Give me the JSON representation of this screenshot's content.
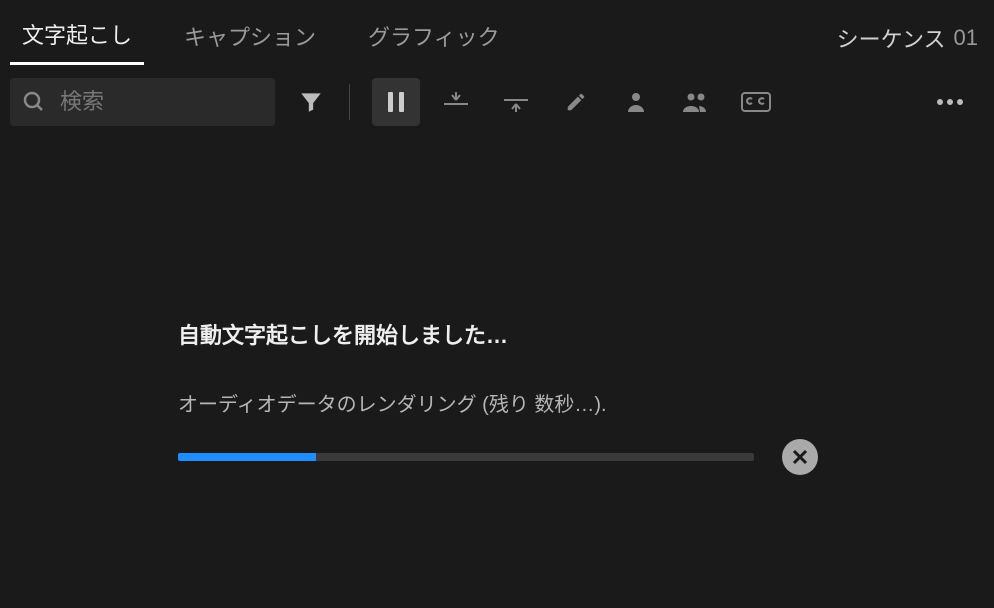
{
  "tabs": {
    "items": [
      {
        "label": "文字起こし",
        "active": true
      },
      {
        "label": "キャプション",
        "active": false
      },
      {
        "label": "グラフィック",
        "active": false
      }
    ]
  },
  "sequence": {
    "label": "シーケンス",
    "number": "01"
  },
  "search": {
    "placeholder": "検索"
  },
  "progress": {
    "title": "自動文字起こしを開始しました…",
    "status": "オーディオデータのレンダリング (残り 数秒…).",
    "percent": 24
  },
  "icons": {
    "search": "search-icon",
    "filter": "filter-icon",
    "pause_segments": "pause-segments-icon",
    "split_up": "split-up-icon",
    "split_down": "split-down-icon",
    "edit": "edit-icon",
    "speaker": "speaker-icon",
    "speakers": "speakers-icon",
    "cc": "cc-icon",
    "more": "more-icon",
    "cancel": "cancel-icon"
  }
}
